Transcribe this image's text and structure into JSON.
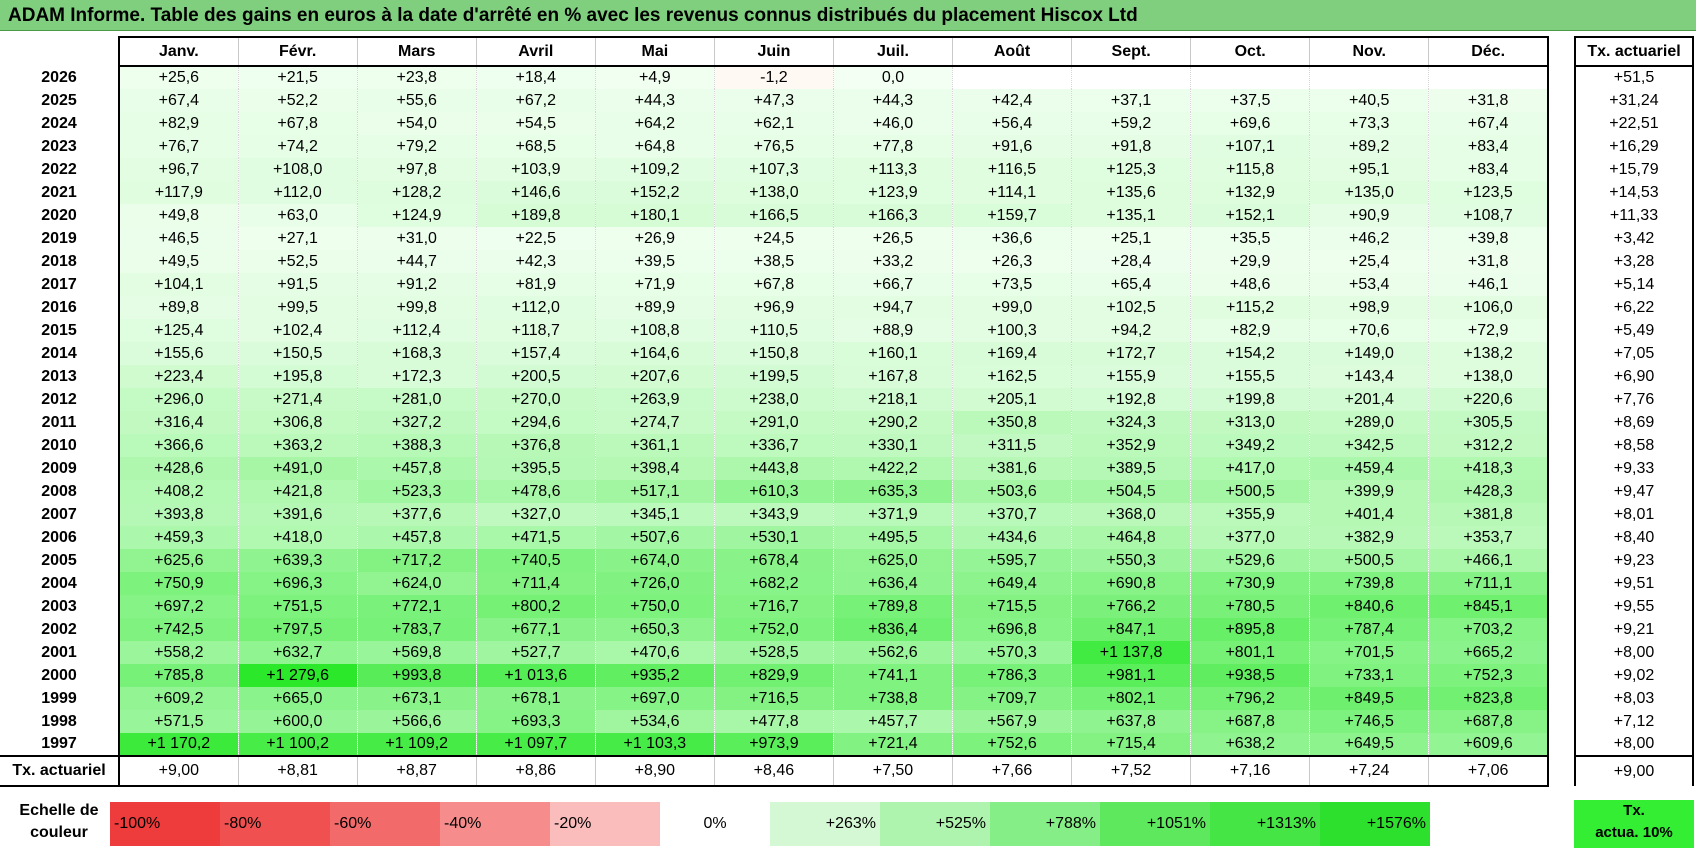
{
  "title": "ADAM Informe. Table des gains en euros à la date d'arrêté en % avec les revenus connus distribués du placement Hiscox Ltd",
  "months": [
    "Janv.",
    "Févr.",
    "Mars",
    "Avril",
    "Mai",
    "Juin",
    "Juil.",
    "Août",
    "Sept.",
    "Oct.",
    "Nov.",
    "Déc."
  ],
  "side_header": "Tx. actuariel",
  "rows": [
    {
      "year": "2026",
      "cells": [
        "+25,6",
        "+21,5",
        "+23,8",
        "+18,4",
        "+4,9",
        "-1,2",
        "0,0",
        "",
        "",
        "",
        "",
        ""
      ],
      "rate": "+51,5"
    },
    {
      "year": "2025",
      "cells": [
        "+67,4",
        "+52,2",
        "+55,6",
        "+67,2",
        "+44,3",
        "+47,3",
        "+44,3",
        "+42,4",
        "+37,1",
        "+37,5",
        "+40,5",
        "+31,8"
      ],
      "rate": "+31,24"
    },
    {
      "year": "2024",
      "cells": [
        "+82,9",
        "+67,8",
        "+54,0",
        "+54,5",
        "+64,2",
        "+62,1",
        "+46,0",
        "+56,4",
        "+59,2",
        "+69,6",
        "+73,3",
        "+67,4"
      ],
      "rate": "+22,51"
    },
    {
      "year": "2023",
      "cells": [
        "+76,7",
        "+74,2",
        "+79,2",
        "+68,5",
        "+64,8",
        "+76,5",
        "+77,8",
        "+91,6",
        "+91,8",
        "+107,1",
        "+89,2",
        "+83,4"
      ],
      "rate": "+16,29"
    },
    {
      "year": "2022",
      "cells": [
        "+96,7",
        "+108,0",
        "+97,8",
        "+103,9",
        "+109,2",
        "+107,3",
        "+113,3",
        "+116,5",
        "+125,3",
        "+115,8",
        "+95,1",
        "+83,4"
      ],
      "rate": "+15,79"
    },
    {
      "year": "2021",
      "cells": [
        "+117,9",
        "+112,0",
        "+128,2",
        "+146,6",
        "+152,2",
        "+138,0",
        "+123,9",
        "+114,1",
        "+135,6",
        "+132,9",
        "+135,0",
        "+123,5"
      ],
      "rate": "+14,53"
    },
    {
      "year": "2020",
      "cells": [
        "+49,8",
        "+63,0",
        "+124,9",
        "+189,8",
        "+180,1",
        "+166,5",
        "+166,3",
        "+159,7",
        "+135,1",
        "+152,1",
        "+90,9",
        "+108,7"
      ],
      "rate": "+11,33"
    },
    {
      "year": "2019",
      "cells": [
        "+46,5",
        "+27,1",
        "+31,0",
        "+22,5",
        "+26,9",
        "+24,5",
        "+26,5",
        "+36,6",
        "+25,1",
        "+35,5",
        "+46,2",
        "+39,8"
      ],
      "rate": "+3,42"
    },
    {
      "year": "2018",
      "cells": [
        "+49,5",
        "+52,5",
        "+44,7",
        "+42,3",
        "+39,5",
        "+38,5",
        "+33,2",
        "+26,3",
        "+28,4",
        "+29,9",
        "+25,4",
        "+31,8"
      ],
      "rate": "+3,28"
    },
    {
      "year": "2017",
      "cells": [
        "+104,1",
        "+91,5",
        "+91,2",
        "+81,9",
        "+71,9",
        "+67,8",
        "+66,7",
        "+73,5",
        "+65,4",
        "+48,6",
        "+53,4",
        "+46,1"
      ],
      "rate": "+5,14"
    },
    {
      "year": "2016",
      "cells": [
        "+89,8",
        "+99,5",
        "+99,8",
        "+112,0",
        "+89,9",
        "+96,9",
        "+94,7",
        "+99,0",
        "+102,5",
        "+115,2",
        "+98,9",
        "+106,0"
      ],
      "rate": "+6,22"
    },
    {
      "year": "2015",
      "cells": [
        "+125,4",
        "+102,4",
        "+112,4",
        "+118,7",
        "+108,8",
        "+110,5",
        "+88,9",
        "+100,3",
        "+94,2",
        "+82,9",
        "+70,6",
        "+72,9"
      ],
      "rate": "+5,49"
    },
    {
      "year": "2014",
      "cells": [
        "+155,6",
        "+150,5",
        "+168,3",
        "+157,4",
        "+164,6",
        "+150,8",
        "+160,1",
        "+169,4",
        "+172,7",
        "+154,2",
        "+149,0",
        "+138,2"
      ],
      "rate": "+7,05"
    },
    {
      "year": "2013",
      "cells": [
        "+223,4",
        "+195,8",
        "+172,3",
        "+200,5",
        "+207,6",
        "+199,5",
        "+167,8",
        "+162,5",
        "+155,9",
        "+155,5",
        "+143,4",
        "+138,0"
      ],
      "rate": "+6,90"
    },
    {
      "year": "2012",
      "cells": [
        "+296,0",
        "+271,4",
        "+281,0",
        "+270,0",
        "+263,9",
        "+238,0",
        "+218,1",
        "+205,1",
        "+192,8",
        "+199,8",
        "+201,4",
        "+220,6"
      ],
      "rate": "+7,76"
    },
    {
      "year": "2011",
      "cells": [
        "+316,4",
        "+306,8",
        "+327,2",
        "+294,6",
        "+274,7",
        "+291,0",
        "+290,2",
        "+350,8",
        "+324,3",
        "+313,0",
        "+289,0",
        "+305,5"
      ],
      "rate": "+8,69"
    },
    {
      "year": "2010",
      "cells": [
        "+366,6",
        "+363,2",
        "+388,3",
        "+376,8",
        "+361,1",
        "+336,7",
        "+330,1",
        "+311,5",
        "+352,9",
        "+349,2",
        "+342,5",
        "+312,2"
      ],
      "rate": "+8,58"
    },
    {
      "year": "2009",
      "cells": [
        "+428,6",
        "+491,0",
        "+457,8",
        "+395,5",
        "+398,4",
        "+443,8",
        "+422,2",
        "+381,6",
        "+389,5",
        "+417,0",
        "+459,4",
        "+418,3"
      ],
      "rate": "+9,33"
    },
    {
      "year": "2008",
      "cells": [
        "+408,2",
        "+421,8",
        "+523,3",
        "+478,6",
        "+517,1",
        "+610,3",
        "+635,3",
        "+503,6",
        "+504,5",
        "+500,5",
        "+399,9",
        "+428,3"
      ],
      "rate": "+9,47"
    },
    {
      "year": "2007",
      "cells": [
        "+393,8",
        "+391,6",
        "+377,6",
        "+327,0",
        "+345,1",
        "+343,9",
        "+371,9",
        "+370,7",
        "+368,0",
        "+355,9",
        "+401,4",
        "+381,8"
      ],
      "rate": "+8,01"
    },
    {
      "year": "2006",
      "cells": [
        "+459,3",
        "+418,0",
        "+457,8",
        "+471,5",
        "+507,6",
        "+530,1",
        "+495,5",
        "+434,6",
        "+464,8",
        "+377,0",
        "+382,9",
        "+353,7"
      ],
      "rate": "+8,40"
    },
    {
      "year": "2005",
      "cells": [
        "+625,6",
        "+639,3",
        "+717,2",
        "+740,5",
        "+674,0",
        "+678,4",
        "+625,0",
        "+595,7",
        "+550,3",
        "+529,6",
        "+500,5",
        "+466,1"
      ],
      "rate": "+9,23"
    },
    {
      "year": "2004",
      "cells": [
        "+750,9",
        "+696,3",
        "+624,0",
        "+711,4",
        "+726,0",
        "+682,2",
        "+636,4",
        "+649,4",
        "+690,8",
        "+730,9",
        "+739,8",
        "+711,1"
      ],
      "rate": "+9,51"
    },
    {
      "year": "2003",
      "cells": [
        "+697,2",
        "+751,5",
        "+772,1",
        "+800,2",
        "+750,0",
        "+716,7",
        "+789,8",
        "+715,5",
        "+766,2",
        "+780,5",
        "+840,6",
        "+845,1"
      ],
      "rate": "+9,55"
    },
    {
      "year": "2002",
      "cells": [
        "+742,5",
        "+797,5",
        "+783,7",
        "+677,1",
        "+650,3",
        "+752,0",
        "+836,4",
        "+696,8",
        "+847,1",
        "+895,8",
        "+787,4",
        "+703,2"
      ],
      "rate": "+9,21"
    },
    {
      "year": "2001",
      "cells": [
        "+558,2",
        "+632,7",
        "+569,8",
        "+527,7",
        "+470,6",
        "+528,5",
        "+562,6",
        "+570,3",
        "+1 137,8",
        "+801,1",
        "+701,5",
        "+665,2"
      ],
      "rate": "+8,00"
    },
    {
      "year": "2000",
      "cells": [
        "+785,8",
        "+1 279,6",
        "+993,8",
        "+1 013,6",
        "+935,2",
        "+829,9",
        "+741,1",
        "+786,3",
        "+981,1",
        "+938,5",
        "+733,1",
        "+752,3"
      ],
      "rate": "+9,02"
    },
    {
      "year": "1999",
      "cells": [
        "+609,2",
        "+665,0",
        "+673,1",
        "+678,1",
        "+697,0",
        "+716,5",
        "+738,8",
        "+709,7",
        "+802,1",
        "+796,2",
        "+849,5",
        "+823,8"
      ],
      "rate": "+8,03"
    },
    {
      "year": "1998",
      "cells": [
        "+571,5",
        "+600,0",
        "+566,6",
        "+693,3",
        "+534,6",
        "+477,8",
        "+457,7",
        "+567,9",
        "+637,8",
        "+687,8",
        "+746,5",
        "+687,8"
      ],
      "rate": "+7,12"
    },
    {
      "year": "1997",
      "cells": [
        "+1 170,2",
        "+1 100,2",
        "+1 109,2",
        "+1 097,7",
        "+1 103,3",
        "+973,9",
        "+721,4",
        "+752,6",
        "+715,4",
        "+638,2",
        "+649,5",
        "+609,6"
      ],
      "rate": "+8,00"
    }
  ],
  "footer": {
    "label": "Tx. actuariel",
    "cells": [
      "+9,00",
      "+8,81",
      "+8,87",
      "+8,86",
      "+8,90",
      "+8,46",
      "+7,50",
      "+7,66",
      "+7,52",
      "+7,16",
      "+7,24",
      "+7,06"
    ],
    "rate": "+9,00"
  },
  "scale": {
    "label_line1": "Echelle de",
    "label_line2": "couleur",
    "items": [
      {
        "label": "-100%",
        "color": "#ee3b3b",
        "kind": "neg"
      },
      {
        "label": "-80%",
        "color": "#f05050",
        "kind": "neg"
      },
      {
        "label": "-60%",
        "color": "#f36a6a",
        "kind": "neg"
      },
      {
        "label": "-40%",
        "color": "#f78c8c",
        "kind": "neg"
      },
      {
        "label": "-20%",
        "color": "#fbbcbc",
        "kind": "neg"
      },
      {
        "label": "0%",
        "color": "#ffffff",
        "kind": "zero"
      },
      {
        "label": "+263%",
        "color": "#d4f8d4",
        "kind": "pos"
      },
      {
        "label": "+525%",
        "color": "#aef3ae",
        "kind": "pos"
      },
      {
        "label": "+788%",
        "color": "#86ee86",
        "kind": "pos"
      },
      {
        "label": "+1051%",
        "color": "#5ee85e",
        "kind": "pos"
      },
      {
        "label": "+1313%",
        "color": "#44e544",
        "kind": "pos"
      },
      {
        "label": "+1576%",
        "color": "#2ee02e",
        "kind": "pos"
      }
    ],
    "end_line1": "Tx.",
    "end_line2": "actua. 10%",
    "end_color": "#33ee33"
  }
}
